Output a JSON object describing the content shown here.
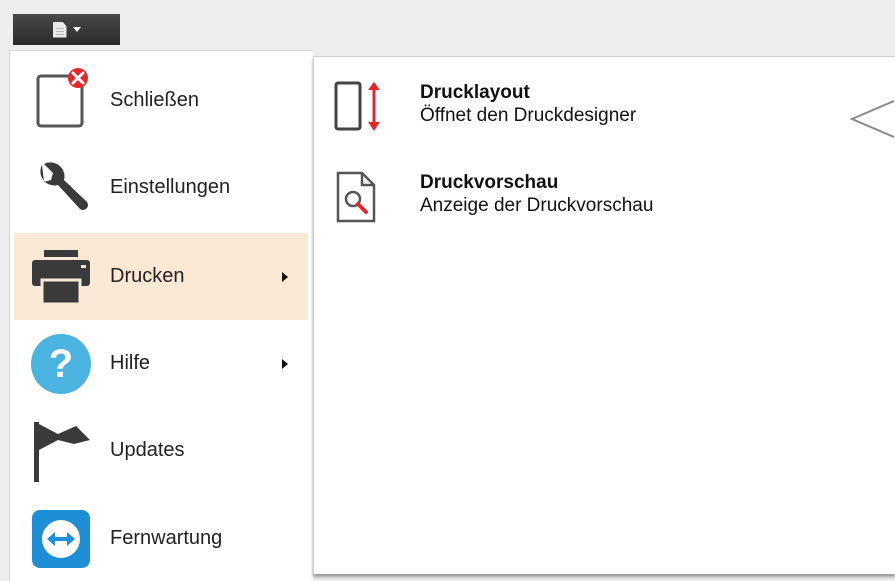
{
  "file_button": {
    "icon": "document-icon",
    "caret": "caret-down-icon"
  },
  "menu": {
    "items": [
      {
        "label": "Schließen",
        "icon": "close-document-icon",
        "has_submenu": false
      },
      {
        "label": "Einstellungen",
        "icon": "wrench-icon",
        "has_submenu": false
      },
      {
        "label": "Drucken",
        "icon": "printer-icon",
        "has_submenu": true,
        "active": true
      },
      {
        "label": "Hilfe",
        "icon": "help-icon",
        "has_submenu": true
      },
      {
        "label": "Updates",
        "icon": "flag-icon",
        "has_submenu": false
      },
      {
        "label": "Fernwartung",
        "icon": "remote-control-icon",
        "has_submenu": false
      }
    ]
  },
  "submenu": {
    "items": [
      {
        "title": "Drucklayout",
        "desc": "Öffnet den Druckdesigner",
        "icon": "print-layout-icon"
      },
      {
        "title": "Druckvorschau",
        "desc": "Anzeige der Druckvorschau",
        "icon": "print-preview-icon"
      }
    ]
  },
  "colors": {
    "active_bg": "#fbe8d5",
    "accent_red": "#e8262a",
    "help_blue": "#4ab3e0",
    "remote_blue": "#1e8fd6"
  }
}
